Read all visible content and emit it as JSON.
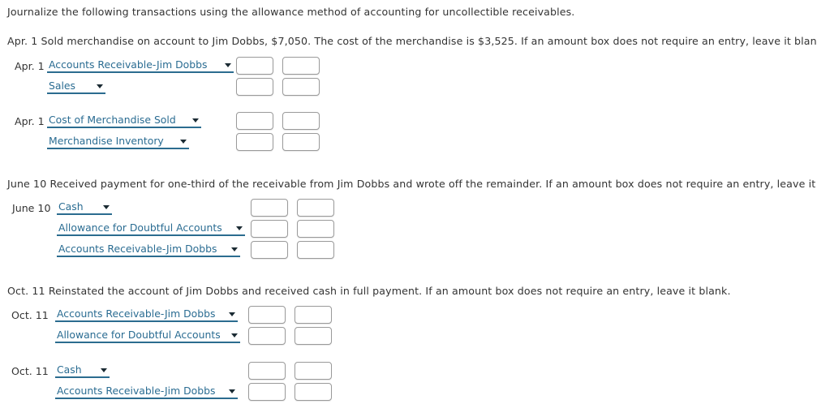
{
  "instructions": {
    "main": "Journalize the following transactions using the allowance method of accounting for uncollectible receivables.",
    "apr": "Apr. 1 Sold merchandise on account to Jim Dobbs, $7,050. The cost of the merchandise is $3,525. If an amount box does not require an entry, leave it blank.",
    "june": "June 10 Received payment for one-third of the receivable from Jim Dobbs and wrote off the remainder. If an amount box does not require an entry, leave it blank.",
    "oct": "Oct. 11 Reinstated the account of Jim Dobbs and received cash in full payment. If an amount box does not require an entry, leave it blank."
  },
  "colors": {
    "account_text": "#2a6c92",
    "underline": "#2b6c8f",
    "box_border": "#9a9a9a",
    "body_text": "#333333"
  },
  "entries": [
    {
      "id": "apr-1-sale",
      "date": "Apr. 1",
      "lines": [
        {
          "account": "Accounts Receivable-Jim Dobbs",
          "debit": "",
          "credit": ""
        },
        {
          "account": "Sales",
          "debit": "",
          "credit": ""
        }
      ]
    },
    {
      "id": "apr-1-cogs",
      "date": "Apr. 1",
      "lines": [
        {
          "account": "Cost of Merchandise Sold",
          "debit": "",
          "credit": ""
        },
        {
          "account": "Merchandise Inventory",
          "debit": "",
          "credit": ""
        }
      ]
    },
    {
      "id": "june-10",
      "date": "June 10",
      "lines": [
        {
          "account": "Cash",
          "debit": "",
          "credit": ""
        },
        {
          "account": "Allowance for Doubtful Accounts",
          "debit": "",
          "credit": ""
        },
        {
          "account": "Accounts Receivable-Jim Dobbs",
          "debit": "",
          "credit": ""
        }
      ]
    },
    {
      "id": "oct-11-reinstate",
      "date": "Oct. 11",
      "lines": [
        {
          "account": "Accounts Receivable-Jim Dobbs",
          "debit": "",
          "credit": ""
        },
        {
          "account": "Allowance for Doubtful Accounts",
          "debit": "",
          "credit": ""
        }
      ]
    },
    {
      "id": "oct-11-receipt",
      "date": "Oct. 11",
      "lines": [
        {
          "account": "Cash",
          "debit": "",
          "credit": ""
        },
        {
          "account": "Accounts Receivable-Jim Dobbs",
          "debit": "",
          "credit": ""
        }
      ]
    }
  ]
}
